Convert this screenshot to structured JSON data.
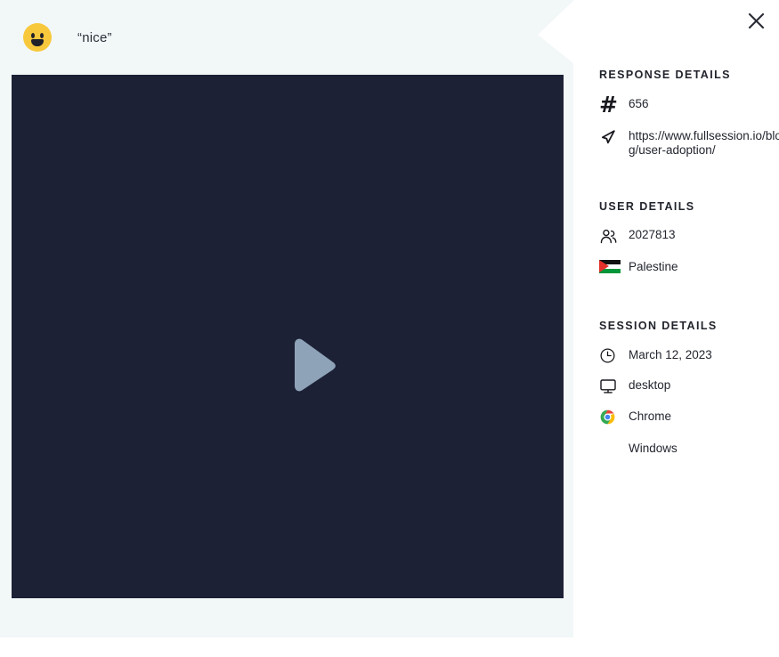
{
  "quote": {
    "emoji_name": "grinning-face-emoji",
    "text": "“nice”"
  },
  "video": {
    "play_label": "play-button",
    "background_color": "#1c2135",
    "play_color": "#8fa3b8"
  },
  "panel": {
    "close_label": "✕",
    "sections": [
      {
        "title": "RESPONSE DETAILS",
        "rows": [
          {
            "icon": "hash-icon",
            "value": "656"
          },
          {
            "icon": "cursor-arrow-icon",
            "value": "https://www.fullsession.io/blog/user-adoption/"
          }
        ]
      },
      {
        "title": "USER DETAILS",
        "rows": [
          {
            "icon": "users-icon",
            "value": "2027813"
          },
          {
            "icon": "palestine-flag-icon",
            "value": "Palestine"
          }
        ]
      },
      {
        "title": "SESSION DETAILS",
        "rows": [
          {
            "icon": "clock-icon",
            "value": "March 12, 2023"
          },
          {
            "icon": "monitor-icon",
            "value": "desktop"
          },
          {
            "icon": "chrome-icon",
            "value": "Chrome"
          },
          {
            "icon": "windows-icon",
            "value": "Windows"
          }
        ]
      }
    ]
  },
  "colors": {
    "backdrop": "#f2f7f8",
    "panel": "#ffffff",
    "text": "#23262f",
    "emoji_yellow": "#f8c83c"
  }
}
